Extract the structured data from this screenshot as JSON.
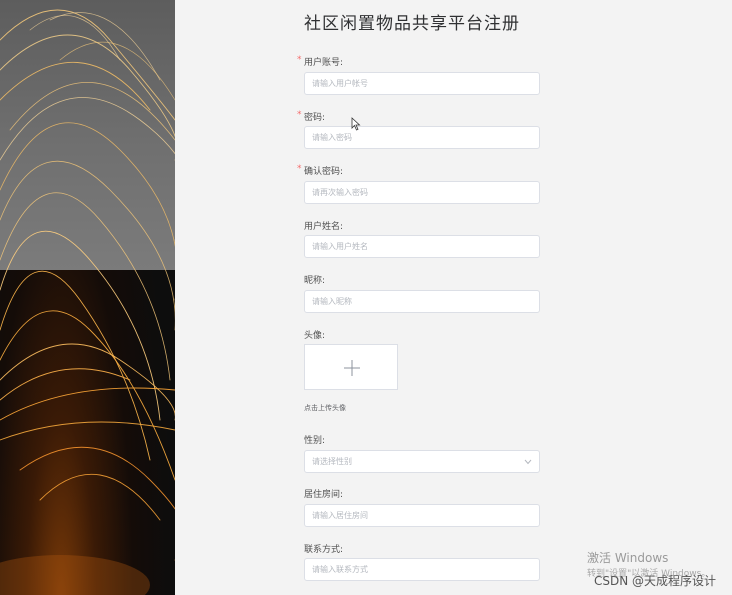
{
  "title": "社区闲置物品共享平台注册",
  "required_mark": "*",
  "fields": {
    "account": {
      "label": "用户账号:",
      "placeholder": "请输入用户帐号"
    },
    "password": {
      "label": "密码:",
      "placeholder": "请输入密码"
    },
    "confirm_password": {
      "label": "确认密码:",
      "placeholder": "请再次输入密码"
    },
    "real_name": {
      "label": "用户姓名:",
      "placeholder": "请输入用户姓名"
    },
    "nickname": {
      "label": "昵称:",
      "placeholder": "请输入昵称"
    },
    "avatar": {
      "label": "头像:",
      "hint": "点击上传头像"
    },
    "gender": {
      "label": "性别:",
      "placeholder": "请选择性别"
    },
    "room": {
      "label": "居住房间:",
      "placeholder": "请输入居住房间"
    },
    "contact": {
      "label": "联系方式:",
      "placeholder": "请输入联系方式"
    }
  },
  "watermark": {
    "line1": "激活 Windows",
    "line2": "转到\"设置\"以激活 Windows。",
    "credit": "CSDN @天成程序设计"
  },
  "colors": {
    "required": "#f56c6c",
    "border": "#dcdfe6",
    "placeholder": "#b4b8bf"
  },
  "icons": {
    "upload": "plus-icon",
    "select": "chevron-down-icon",
    "cursor": "mouse-pointer-icon"
  }
}
